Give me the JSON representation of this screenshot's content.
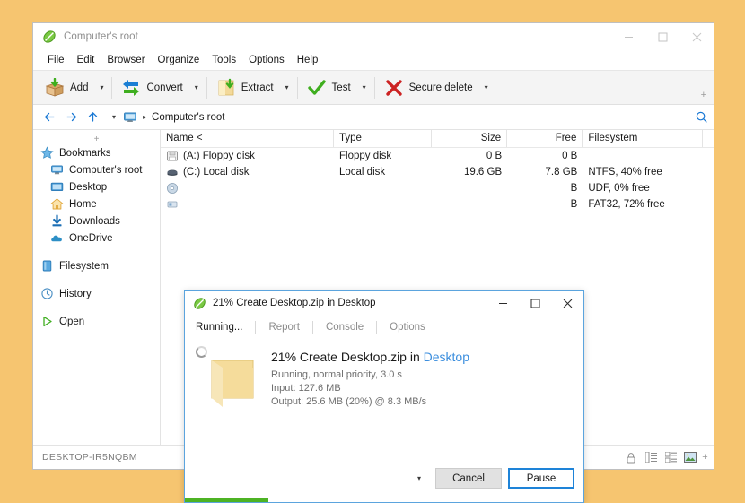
{
  "desktop": {
    "background": "#f6c570"
  },
  "window": {
    "title": "Computer's root",
    "icon": "peazip-icon",
    "controls": {
      "minimize": "–",
      "maximize": "□",
      "close": "✕"
    },
    "menu": [
      "File",
      "Edit",
      "Browser",
      "Organize",
      "Tools",
      "Options",
      "Help"
    ],
    "toolbar": {
      "buttons": [
        {
          "label": "Add",
          "icon": "add-archive-icon",
          "caret": true
        },
        {
          "label": "Convert",
          "icon": "convert-icon",
          "caret": true
        },
        {
          "label": "Extract",
          "icon": "extract-folder-icon",
          "caret": true
        },
        {
          "label": "Test",
          "icon": "test-check-icon",
          "caret": true
        },
        {
          "label": "Secure delete",
          "icon": "secure-delete-icon",
          "caret": true
        }
      ],
      "overflow": "+"
    },
    "address": {
      "back": "back-arrow-icon",
      "forward": "forward-arrow-icon",
      "up": "up-arrow-icon",
      "history_caret": "▾",
      "path_icon": "computer-icon",
      "path": "Computer's root",
      "separator": "▸",
      "search_icon": "search-icon"
    },
    "statusbar": {
      "machine": "DESKTOP-IR5NQBM",
      "icons": [
        "lock-icon",
        "details-view-icon",
        "list-view-icon",
        "thumbnail-view-icon"
      ],
      "plus": "+"
    }
  },
  "sidebar": {
    "collapse": "+",
    "groups": [
      {
        "header": {
          "label": "Bookmarks",
          "icon": "star-icon"
        },
        "items": [
          {
            "label": "Computer's root",
            "icon": "computer-icon"
          },
          {
            "label": "Desktop",
            "icon": "desktop-icon"
          },
          {
            "label": "Home",
            "icon": "home-icon"
          },
          {
            "label": "Downloads",
            "icon": "download-icon"
          },
          {
            "label": "OneDrive",
            "icon": "cloud-icon"
          }
        ]
      },
      {
        "header": {
          "label": "Filesystem",
          "icon": "filesystem-icon"
        },
        "items": []
      },
      {
        "header": {
          "label": "History",
          "icon": "history-clock-icon"
        },
        "items": []
      },
      {
        "header": {
          "label": "Open",
          "icon": "play-triangle-icon"
        },
        "items": []
      }
    ]
  },
  "filelist": {
    "columns": [
      "Name <",
      "Type",
      "Size",
      "Free",
      "Filesystem"
    ],
    "rows": [
      {
        "icon": "floppy-disk-icon",
        "name": "(A:) Floppy disk",
        "type": "Floppy disk",
        "size": "0 B",
        "free": "0 B",
        "filesystem": ""
      },
      {
        "icon": "hard-disk-icon",
        "name": "(C:) Local disk",
        "type": "Local disk",
        "size": "19.6 GB",
        "free": "7.8 GB",
        "filesystem": "NTFS, 40% free"
      },
      {
        "icon": "optical-disk-icon",
        "name": "",
        "type": "",
        "size": "",
        "free": "B",
        "filesystem": "UDF, 0% free"
      },
      {
        "icon": "removable-disk-icon",
        "name": "",
        "type": "",
        "size": "",
        "free": "B",
        "filesystem": "FAT32, 72% free"
      }
    ]
  },
  "dialog": {
    "icon": "peazip-icon",
    "title": "21% Create Desktop.zip in Desktop",
    "controls": {
      "minimize": "–",
      "maximize": "□",
      "close": "✕"
    },
    "tabs": [
      {
        "label": "Running...",
        "active": true
      },
      {
        "label": "Report",
        "active": false
      },
      {
        "label": "Console",
        "active": false
      },
      {
        "label": "Options",
        "active": false
      }
    ],
    "task": {
      "spinner": "loading-spinner-icon",
      "folder_icon": "folder-icon",
      "heading_prefix": "21% Create Desktop.zip in ",
      "heading_link": "Desktop",
      "status": "Running, normal priority, 3.0 s",
      "input": "Input: 127.6 MB",
      "output": "Output: 25.6 MB (20%) @ 8.3 MB/s"
    },
    "actions": {
      "more_caret": "▾",
      "cancel": "Cancel",
      "pause": "Pause"
    },
    "progress": {
      "percent": 21,
      "color": "#4db324"
    }
  }
}
